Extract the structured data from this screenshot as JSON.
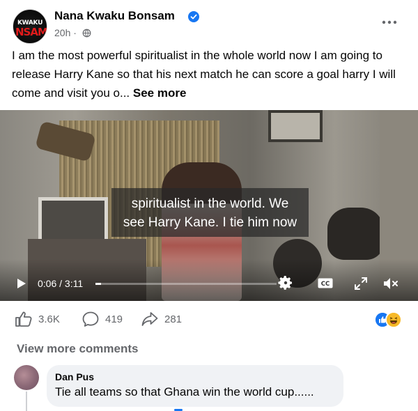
{
  "post": {
    "author": "Nana Kwaku Bonsam",
    "avatar_logo_top": "KWAKU",
    "avatar_logo_bottom": "NSAM",
    "time": "20h",
    "privacy_icon": "globe-icon",
    "more_icon": "more-horizontal-icon",
    "text": "I am the most powerful spiritualist in the whole world now I am going to release Harry Kane so that his next match he can score a goal harry I will come and visit you o... ",
    "see_more": "See more"
  },
  "video": {
    "subtitle_line1": "spiritualist in the world. We",
    "subtitle_line2": "see Harry Kane. I tie him now",
    "current_time": "0:06",
    "separator": " / ",
    "duration": "3:11",
    "progress_fraction": 0.031
  },
  "stats": {
    "likes": "3.6K",
    "comments": "419",
    "shares": "281",
    "reactions": [
      "like",
      "haha"
    ]
  },
  "comments_section": {
    "view_more": "View more comments",
    "items": [
      {
        "author": "Dan Pus",
        "text": "Tie all teams so that Ghana win the world cup......"
      }
    ]
  },
  "colors": {
    "accent": "#1877f2",
    "secondary_text": "#65676b",
    "bubble": "#f0f2f5"
  }
}
